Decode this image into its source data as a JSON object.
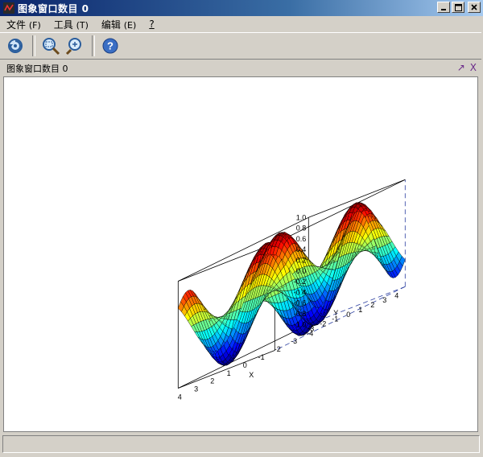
{
  "window": {
    "title": "图象窗口数目 0",
    "buttons": {
      "minimize": "_",
      "maximize": "□",
      "close": "×"
    }
  },
  "menu": [
    {
      "label": "文件",
      "accel": "(F)"
    },
    {
      "label": "工具",
      "accel": "(T)"
    },
    {
      "label": "编辑",
      "accel": "(E)"
    },
    {
      "label": "?",
      "accel": ""
    }
  ],
  "toolbar": {
    "items": [
      {
        "icon": "rotate-icon"
      },
      {
        "icon": "zoom-in-icon"
      },
      {
        "icon": "zoom-fit-icon"
      },
      {
        "icon": "help-icon"
      }
    ]
  },
  "panel": {
    "title": "图象窗口数目 0",
    "undock": "↗",
    "close": "X"
  },
  "chart_data": {
    "type": "surface",
    "function": "sin(x)*cos(y)",
    "x_range": [
      -4,
      4
    ],
    "y_range": [
      -4,
      4
    ],
    "z_range": [
      -1.0,
      1.0
    ],
    "xlabel": "X",
    "ylabel": "Y",
    "x_ticks": [
      "4",
      "3",
      "2",
      "1",
      "0",
      "-1",
      "-2",
      "-3",
      "-4"
    ],
    "y_ticks": [
      "-3",
      "-2",
      "-1",
      "0",
      "1",
      "2",
      "3",
      "4"
    ],
    "z_ticks": [
      "1.0",
      "0.8",
      "0.6",
      "0.4",
      "0.2",
      "0.0",
      "-0.2",
      "-0.4",
      "-0.6",
      "-0.8",
      "-1.0"
    ],
    "colormap": "jet"
  }
}
